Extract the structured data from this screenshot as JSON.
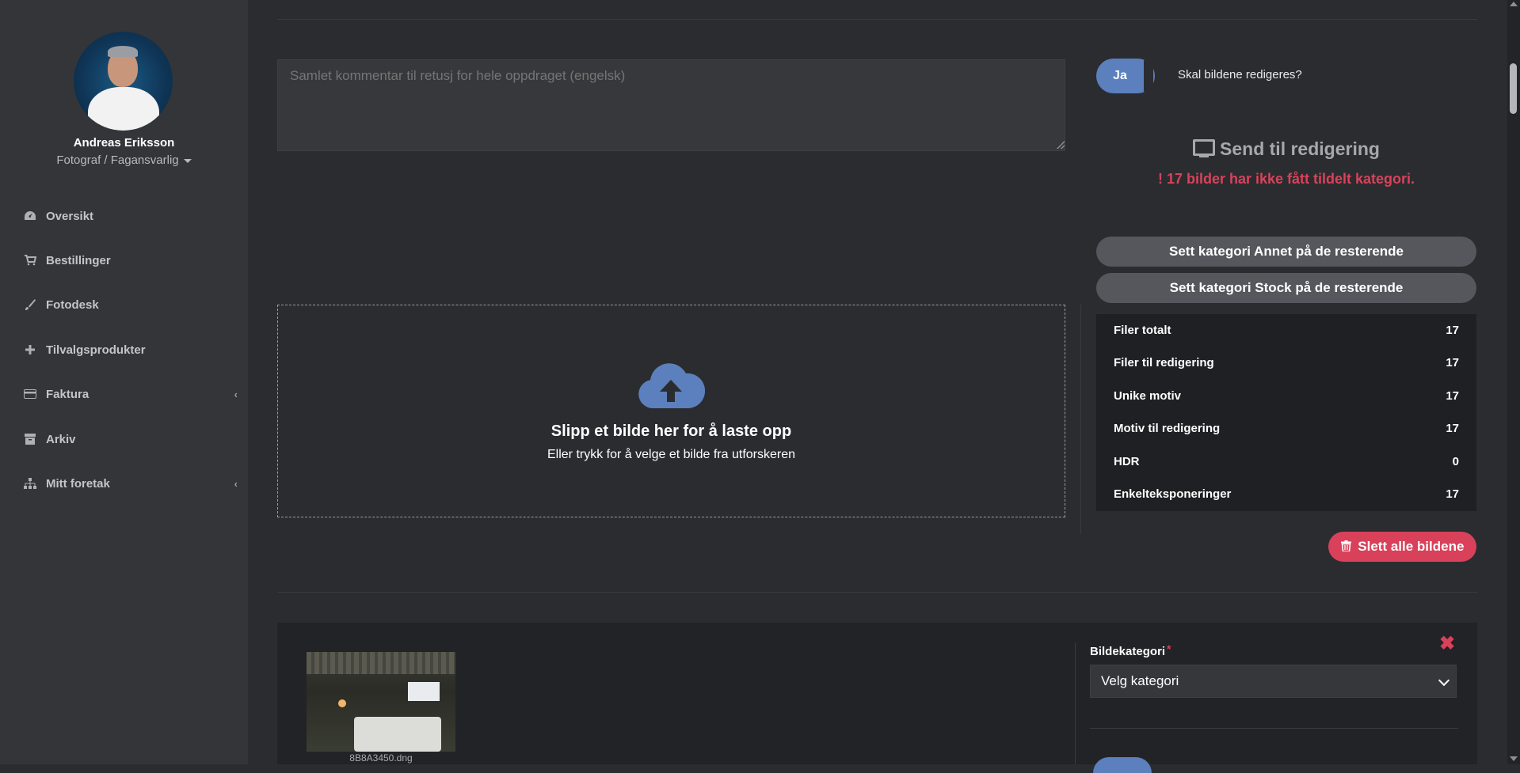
{
  "user": {
    "name": "Andreas Eriksson",
    "role": "Fotograf / Fagansvarlig"
  },
  "nav": {
    "items": [
      {
        "label": "Oversikt",
        "icon": "dashboard-icon"
      },
      {
        "label": "Bestillinger",
        "icon": "cart-icon"
      },
      {
        "label": "Fotodesk",
        "icon": "brush-icon"
      },
      {
        "label": "Tilvalgsprodukter",
        "icon": "plus-icon"
      },
      {
        "label": "Faktura",
        "icon": "credit-card-icon",
        "chevron": "‹"
      },
      {
        "label": "Arkiv",
        "icon": "archive-icon"
      },
      {
        "label": "Mitt foretak",
        "icon": "sitemap-icon",
        "chevron": "‹"
      }
    ]
  },
  "comment": {
    "placeholder": "Samlet kommentar til retusj for hele oppdraget (engelsk)"
  },
  "edit_toggle": {
    "label": "Ja",
    "question": "Skal bildene redigeres?"
  },
  "send": {
    "title": "Send til redigering",
    "warning": "! 17 bilder har ikke fått tildelt kategori."
  },
  "buttons": {
    "set_other": "Sett kategori Annet på de resterende",
    "set_stock": "Sett kategori Stock på de resterende",
    "delete_all": "Slett alle bildene"
  },
  "stats": [
    {
      "label": "Filer totalt",
      "value": "17"
    },
    {
      "label": "Filer til redigering",
      "value": "17"
    },
    {
      "label": "Unike motiv",
      "value": "17"
    },
    {
      "label": "Motiv til redigering",
      "value": "17"
    },
    {
      "label": "HDR",
      "value": "0"
    },
    {
      "label": "Enkelteksponeringer",
      "value": "17"
    }
  ],
  "dropzone": {
    "title": "Slipp et bilde her for å laste opp",
    "subtitle": "Eller trykk for å velge et bilde fra utforskeren"
  },
  "image_item": {
    "filename": "8B8A3450.dng",
    "category_label": "Bildekategori",
    "required_mark": "*",
    "category_value": "Velg kategori",
    "close": "✖"
  },
  "colors": {
    "accent": "#5b80bd",
    "danger": "#d9415a",
    "sidebar": "#343539",
    "background": "#2b2c30"
  }
}
